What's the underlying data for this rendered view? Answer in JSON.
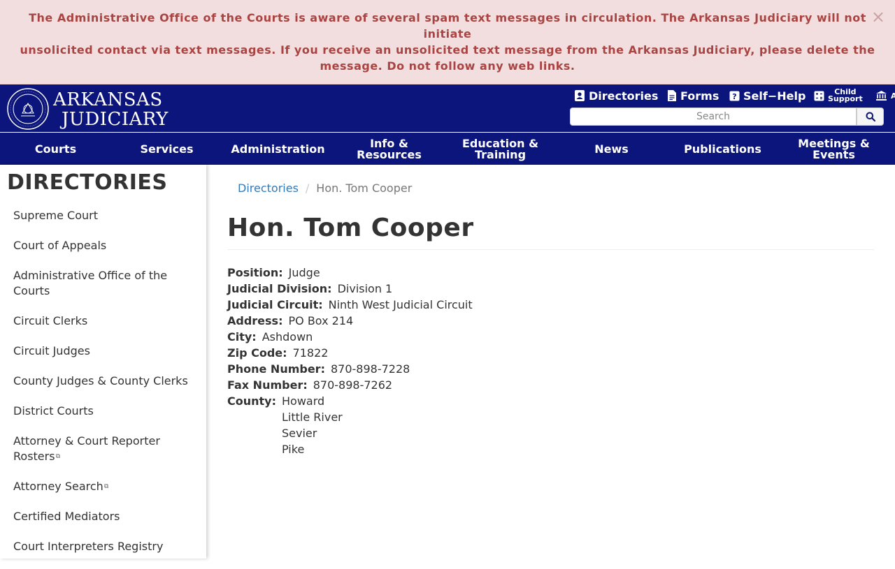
{
  "alert": {
    "line1": "The Administrative Office of the Courts is aware of several spam text messages in circulation.  The Arkansas Judiciary will not initiate",
    "line2": "unsolicited contact via text messages. If you receive an unsolicited text message from the Arkansas Judiciary, please delete the",
    "line3": "message. Do not follow any web links.",
    "close": "×"
  },
  "header": {
    "logo_line1": "ARKANSAS",
    "logo_line2": "JUDICIARY",
    "util_links": [
      {
        "label": "Directories",
        "icon": "directory-icon"
      },
      {
        "label": "Forms",
        "icon": "document-icon"
      },
      {
        "label": "Self−Help",
        "icon": "help-icon"
      },
      {
        "label_line1": "Child",
        "label_line2": "Support",
        "icon": "calculator-icon"
      },
      {
        "label": "A",
        "icon": "courthouse-icon"
      }
    ],
    "search_placeholder": "Search"
  },
  "nav": [
    {
      "label": "Courts"
    },
    {
      "label": "Services"
    },
    {
      "label": "Administration"
    },
    {
      "label": "Info & Resources"
    },
    {
      "label": "Education & Training"
    },
    {
      "label": "News"
    },
    {
      "label": "Publications"
    },
    {
      "label": "Meetings & Events"
    }
  ],
  "sidebar": {
    "title": "DIRECTORIES",
    "items": [
      {
        "label": "Supreme Court"
      },
      {
        "label": "Court of Appeals"
      },
      {
        "label": "Administrative Office of the Courts"
      },
      {
        "label": "Circuit Clerks"
      },
      {
        "label": "Circuit Judges"
      },
      {
        "label": "County Judges & County Clerks"
      },
      {
        "label": "District Courts"
      },
      {
        "label": "Attorney & Court Reporter Rosters",
        "external": "⧉"
      },
      {
        "label": "Attorney Search",
        "external": "⧉"
      },
      {
        "label": "Certified Mediators"
      },
      {
        "label": "Court Interpreters Registry"
      }
    ]
  },
  "breadcrumb": {
    "parent": "Directories",
    "separator": "/",
    "current": "Hon. Tom Cooper"
  },
  "page_title": "Hon. Tom Cooper",
  "details": {
    "position": {
      "label": "Position:",
      "value": "Judge"
    },
    "division": {
      "label": "Judicial Division:",
      "value": "Division 1"
    },
    "circuit": {
      "label": "Judicial Circuit:",
      "value": "Ninth West Judicial Circuit"
    },
    "address": {
      "label": "Address:",
      "value": "PO Box 214"
    },
    "city": {
      "label": "City:",
      "value": "Ashdown"
    },
    "zip": {
      "label": "Zip Code:",
      "value": "71822"
    },
    "phone": {
      "label": "Phone Number:",
      "value": "870-898-7228"
    },
    "fax": {
      "label": "Fax Number:",
      "value": "870-898-7262"
    },
    "county": {
      "label": "County:",
      "values": [
        "Howard",
        "Little River",
        "Sevier",
        "Pike"
      ]
    }
  },
  "colors": {
    "header_bg": "#0b157b",
    "alert_bg": "#f2dede",
    "alert_text": "#a94442",
    "link": "#337ab7"
  }
}
